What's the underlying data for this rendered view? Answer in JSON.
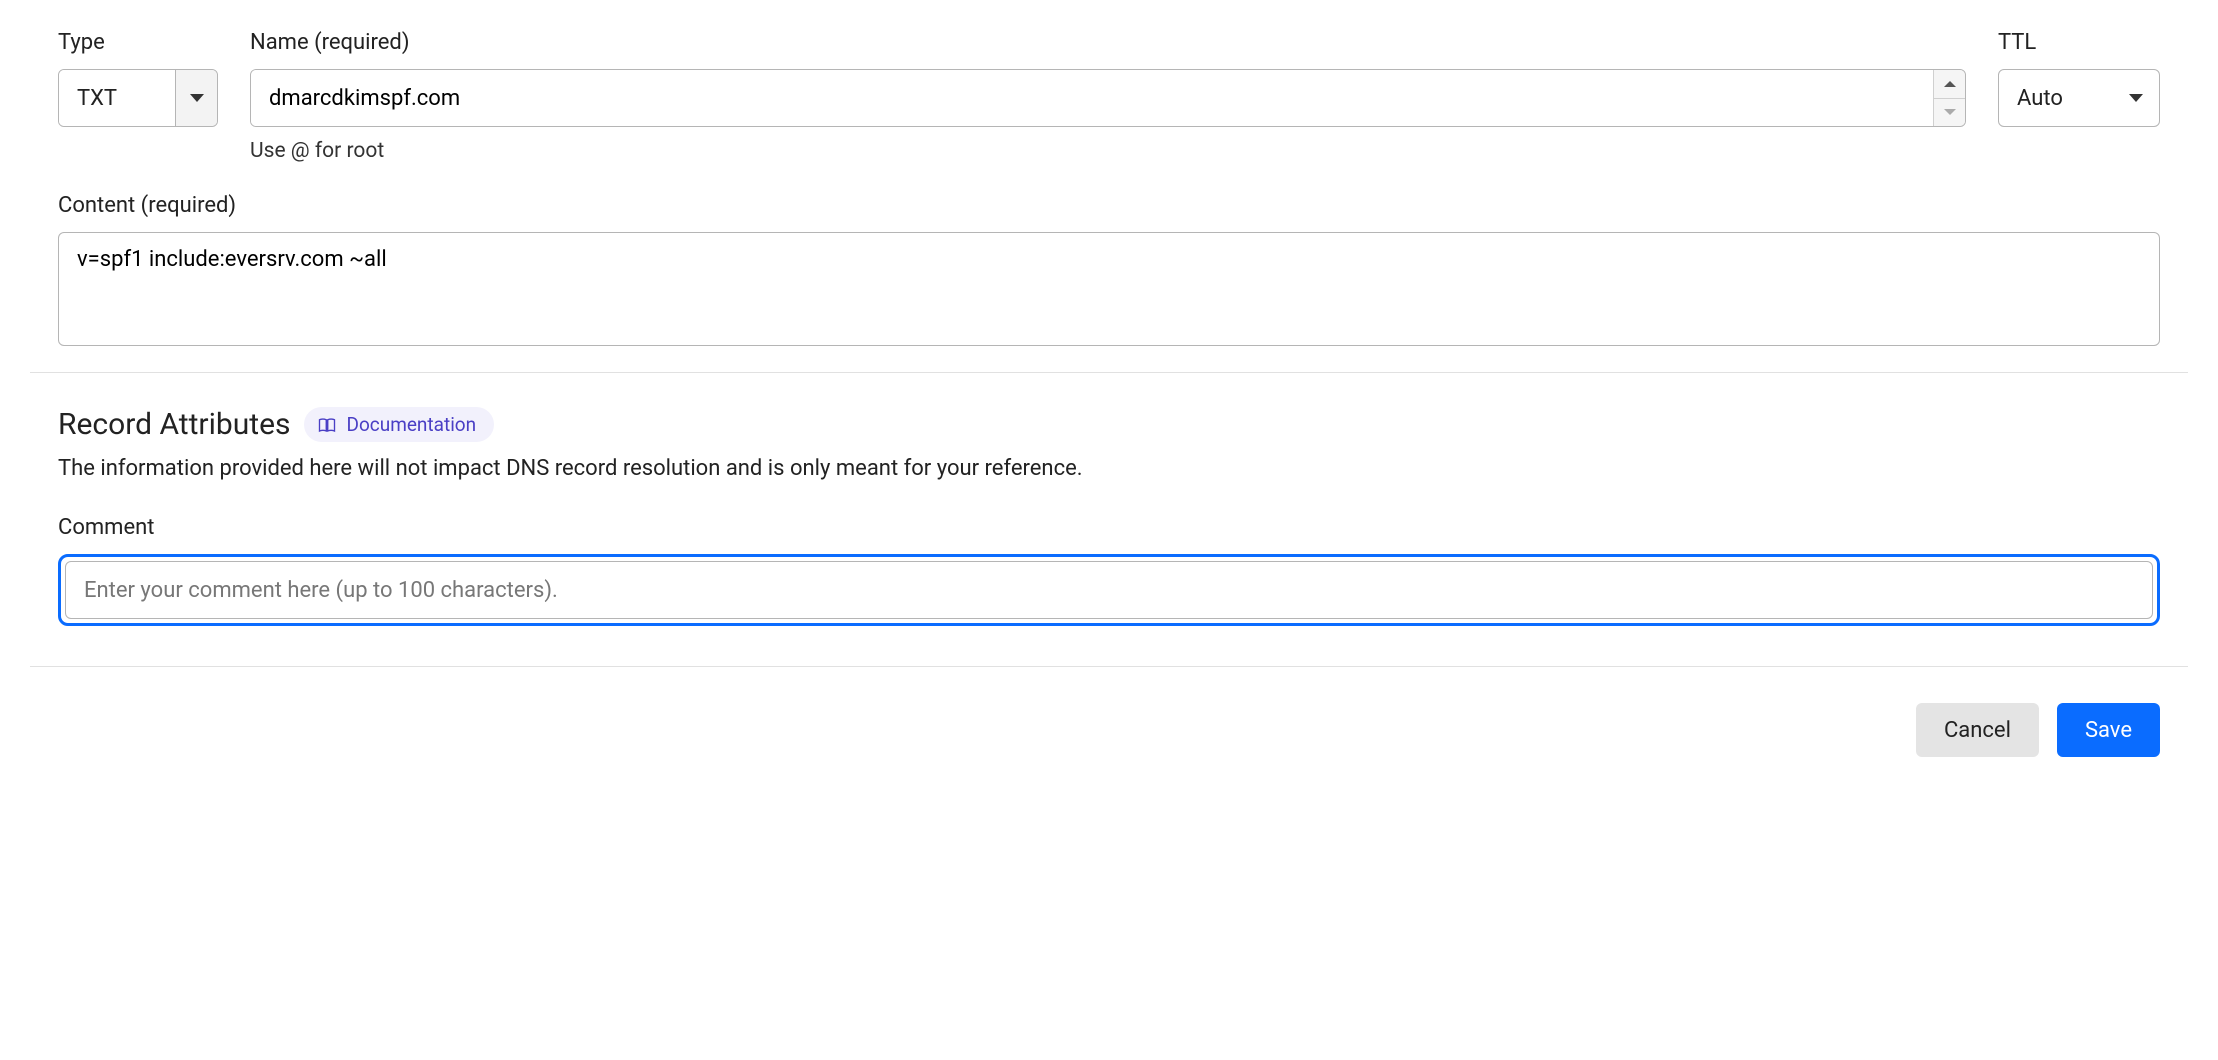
{
  "fields": {
    "type": {
      "label": "Type",
      "value": "TXT"
    },
    "name": {
      "label": "Name (required)",
      "value": "dmarcdkimspf.com",
      "hint": "Use @ for root"
    },
    "ttl": {
      "label": "TTL",
      "value": "Auto"
    },
    "content": {
      "label": "Content (required)",
      "value": "v=spf1 include:eversrv.com ~all"
    }
  },
  "attributes": {
    "title": "Record Attributes",
    "doc_link": "Documentation",
    "description": "The information provided here will not impact DNS record resolution and is only meant for your reference.",
    "comment": {
      "label": "Comment",
      "placeholder": "Enter your comment here (up to 100 characters).",
      "value": ""
    }
  },
  "actions": {
    "cancel": "Cancel",
    "save": "Save"
  }
}
